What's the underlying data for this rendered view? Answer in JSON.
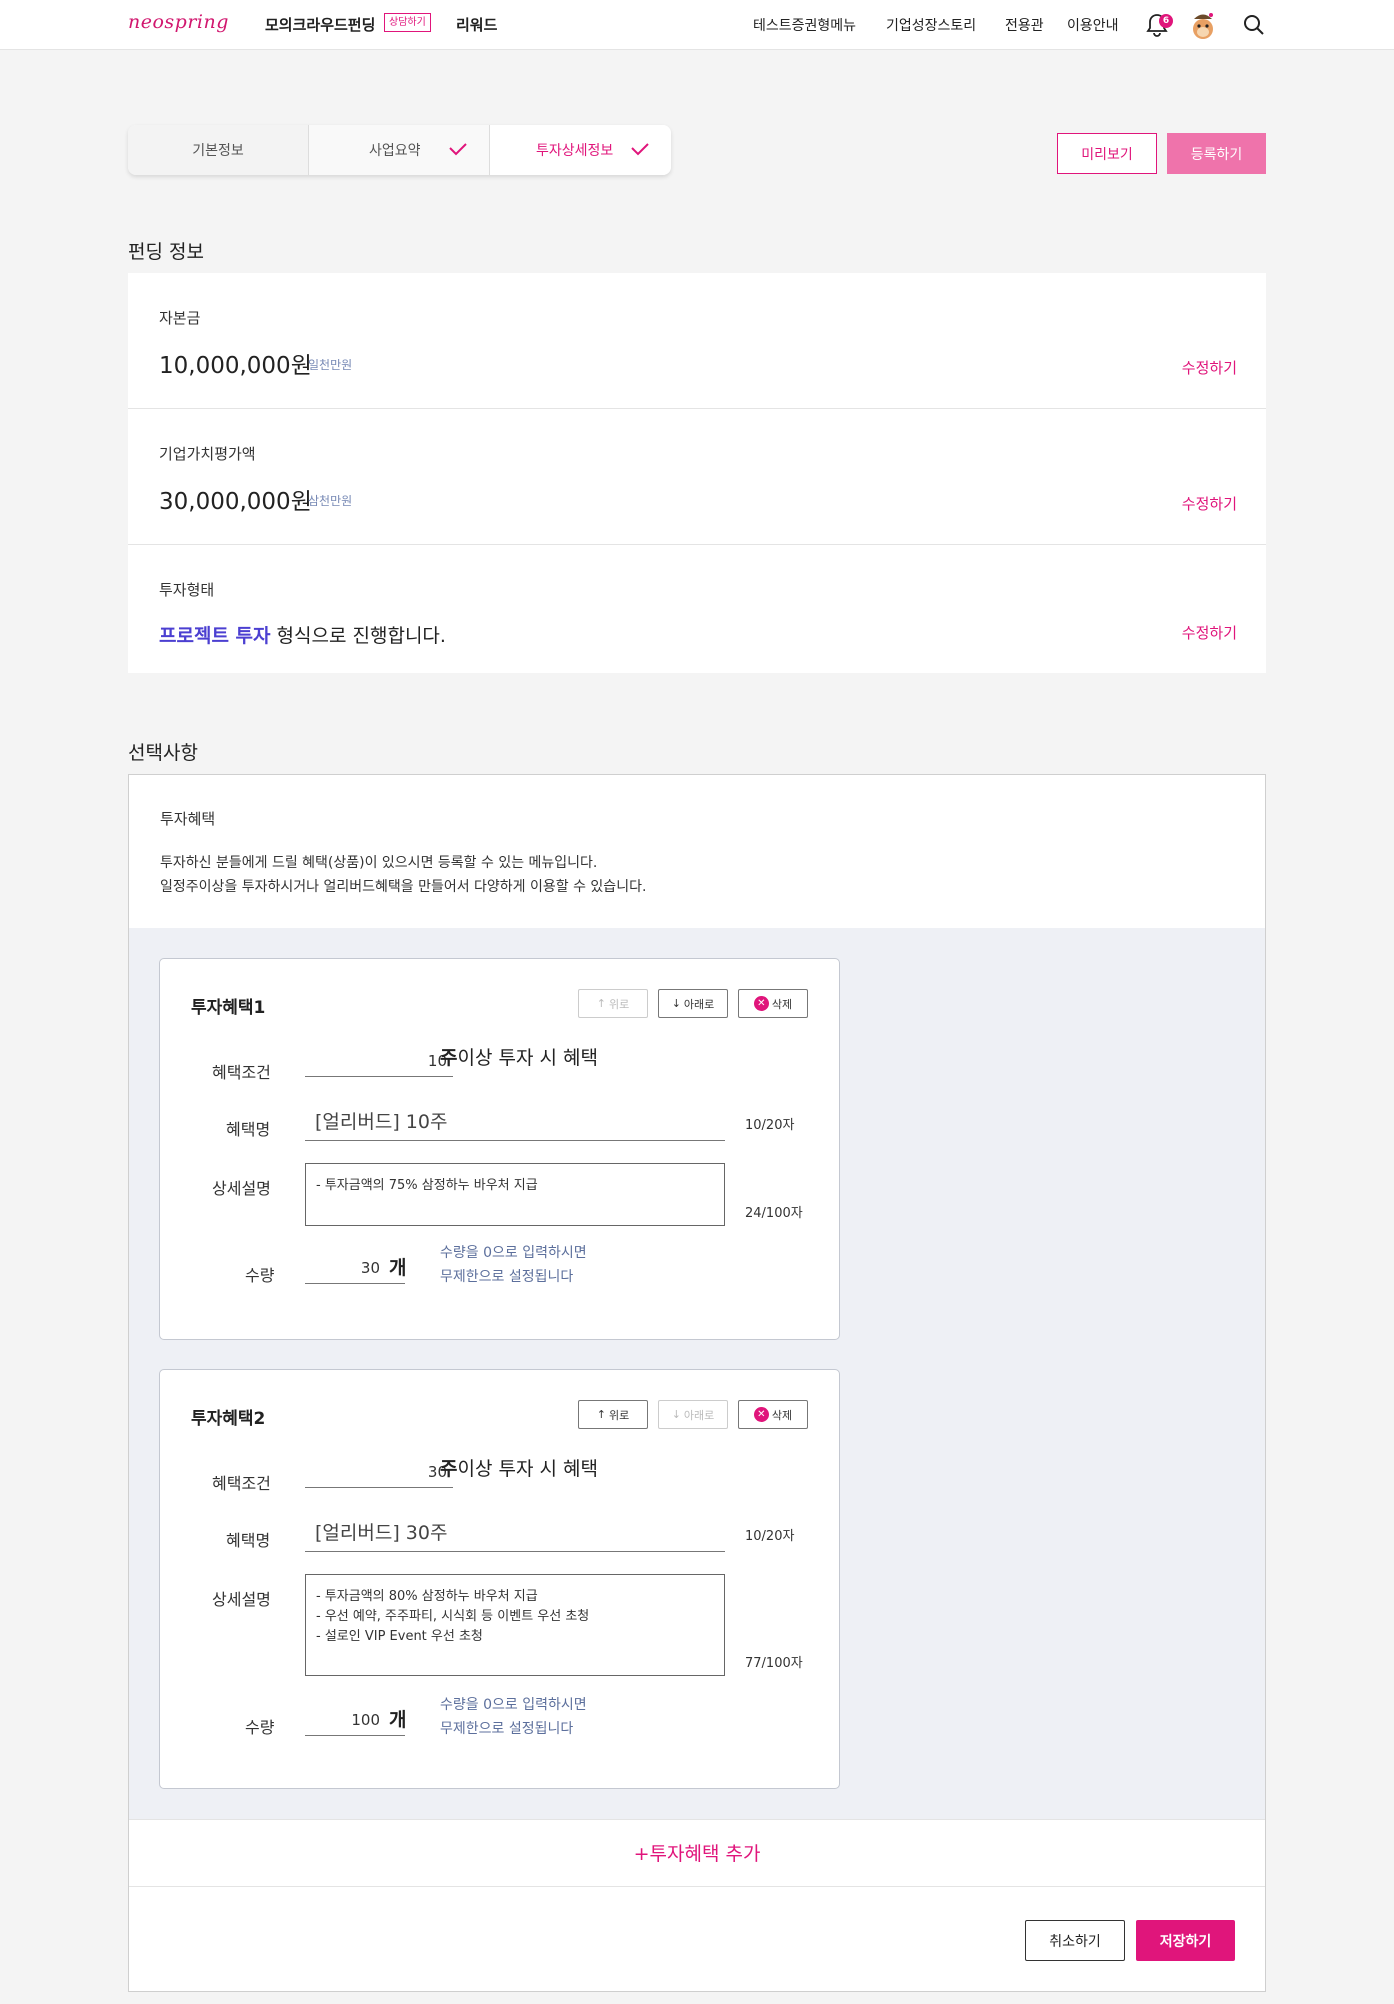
{
  "colors": {
    "brand": "#e0157b",
    "accent_blue": "#4b3fd1",
    "hint": "#5c6f9c"
  },
  "header": {
    "logo": "neospring",
    "nav_main": "모의크라우드펀딩",
    "nav_badge": "상담하기",
    "nav_reward": "리워드",
    "nav_right": [
      "테스트증권형메뉴",
      "기업성장스토리",
      "전용관",
      "이용안내"
    ],
    "notif_count": "6"
  },
  "steps": [
    "기본정보",
    "사업요약",
    "투자상세정보"
  ],
  "actions": {
    "preview": "미리보기",
    "register": "등록하기"
  },
  "funding": {
    "title": "펀딩 정보",
    "rows": [
      {
        "label": "자본금",
        "value": "10,000,000원",
        "sub": "일천만원",
        "edit": "수정하기"
      },
      {
        "label": "기업가치평가액",
        "value": "30,000,000원",
        "sub": "삼천만원",
        "edit": "수정하기"
      },
      {
        "label": "투자형태",
        "value_strong": "프로젝트 투자",
        "value_rest": " 형식으로 진행합니다.",
        "edit": "수정하기"
      }
    ]
  },
  "options": {
    "title": "선택사항",
    "benefit_title": "투자혜택",
    "desc1": "투자하신 분들에게 드릴 혜택(상품)이 있으시면 등록할 수 있는 메뉴입니다.",
    "desc2": "일정주이상을 투자하시거나 얼리버드혜택을 만들어서 다양하게 이용할 수 있습니다.",
    "labels": {
      "condition": "혜택조건",
      "name": "혜택명",
      "detail": "상세설명",
      "qty": "수량"
    },
    "unit_condition_bold": "주",
    "unit_condition_rest": "이상 투자 시 혜택",
    "unit_qty": "개",
    "hint1": "수량을 0으로 입력하시면",
    "hint2": "무제한으로 설정됩니다",
    "btn_up": "위로",
    "btn_down": "아래로",
    "btn_delete": "삭제",
    "cards": [
      {
        "title": "투자혜택1",
        "condition": "10",
        "name": "[얼리버드] 10주",
        "name_count": "10/20자",
        "detail": [
          "- 투자금액의 75% 삼정하누 바우처 지급"
        ],
        "detail_count": "24/100자",
        "qty": "30"
      },
      {
        "title": "투자혜택2",
        "condition": "30",
        "name": "[얼리버드] 30주",
        "name_count": "10/20자",
        "detail": [
          "- 투자금액의 80% 삼정하누 바우처 지급",
          "- 우선 예약, 주주파티, 시식회 등 이벤트 우선 초청",
          "- 설로인 VIP Event 우선 초청"
        ],
        "detail_count": "77/100자",
        "qty": "100"
      }
    ],
    "add_label": "+투자혜택 추가",
    "cancel": "취소하기",
    "save": "저장하기"
  }
}
